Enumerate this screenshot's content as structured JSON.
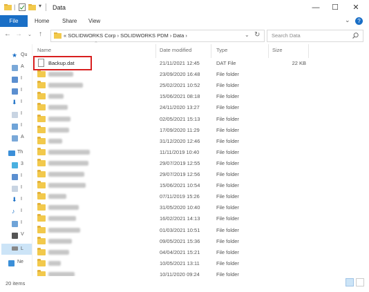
{
  "window": {
    "title": "Data",
    "controls": {
      "minimize": "—",
      "maximize": "☐",
      "close": "✕"
    }
  },
  "ribbon": {
    "file_tab": "File",
    "tabs": [
      "Home",
      "Share",
      "View"
    ]
  },
  "address": {
    "prefix": "«",
    "breadcrumb": [
      "SOLIDWORKS Corp",
      "SOLIDWORKS PDM",
      "Data"
    ],
    "separator": "›"
  },
  "search": {
    "placeholder": "Search Data"
  },
  "sidebar": {
    "items": [
      {
        "label": "Qu",
        "icon": "star-icon"
      },
      {
        "label": "A",
        "icon": "app-icon"
      },
      {
        "label": "I",
        "icon": "drive-icon"
      },
      {
        "label": "I",
        "icon": "drive-icon"
      },
      {
        "label": "I",
        "icon": "download-icon"
      },
      {
        "label": "I",
        "icon": "document-icon"
      },
      {
        "label": "I",
        "icon": "picture-icon"
      },
      {
        "label": "A",
        "icon": "app-icon"
      },
      {
        "label": "Th",
        "icon": "computer-icon"
      },
      {
        "label": "3",
        "icon": "cube-icon"
      },
      {
        "label": "I",
        "icon": "drive-icon"
      },
      {
        "label": "I",
        "icon": "document-icon"
      },
      {
        "label": "I",
        "icon": "download-icon"
      },
      {
        "label": "I",
        "icon": "music-icon"
      },
      {
        "label": "I",
        "icon": "picture-icon"
      },
      {
        "label": "V",
        "icon": "video-icon"
      },
      {
        "label": "L",
        "icon": "disk-icon"
      },
      {
        "label": "Ne",
        "icon": "network-icon"
      }
    ]
  },
  "columns": {
    "name": "Name",
    "date": "Date modified",
    "type": "Type",
    "size": "Size"
  },
  "files": [
    {
      "name": "Backup.dat",
      "date": "21/11/2021 12:45",
      "type": "DAT File",
      "size": "22 KB",
      "kind": "file",
      "highlighted": true
    },
    {
      "name": "",
      "date": "23/09/2020 16:48",
      "type": "File folder",
      "size": "",
      "kind": "folder",
      "highlighted": false
    },
    {
      "name": "",
      "date": "25/02/2021 10:52",
      "type": "File folder",
      "size": "",
      "kind": "folder",
      "highlighted": false
    },
    {
      "name": "",
      "date": "15/06/2021 08:18",
      "type": "File folder",
      "size": "",
      "kind": "folder",
      "highlighted": false
    },
    {
      "name": "",
      "date": "24/11/2020 13:27",
      "type": "File folder",
      "size": "",
      "kind": "folder",
      "highlighted": false
    },
    {
      "name": "",
      "date": "02/05/2021 15:13",
      "type": "File folder",
      "size": "",
      "kind": "folder",
      "highlighted": false
    },
    {
      "name": "",
      "date": "17/09/2020 11:29",
      "type": "File folder",
      "size": "",
      "kind": "folder",
      "highlighted": false
    },
    {
      "name": "",
      "date": "31/12/2020 12:46",
      "type": "File folder",
      "size": "",
      "kind": "folder",
      "highlighted": false
    },
    {
      "name": "",
      "date": "11/11/2019 10:40",
      "type": "File folder",
      "size": "",
      "kind": "folder",
      "highlighted": false
    },
    {
      "name": "",
      "date": "29/07/2019 12:55",
      "type": "File folder",
      "size": "",
      "kind": "folder",
      "highlighted": false
    },
    {
      "name": "",
      "date": "29/07/2019 12:56",
      "type": "File folder",
      "size": "",
      "kind": "folder",
      "highlighted": false
    },
    {
      "name": "",
      "date": "15/06/2021 10:54",
      "type": "File folder",
      "size": "",
      "kind": "folder",
      "highlighted": false
    },
    {
      "name": "",
      "date": "07/11/2019 15:26",
      "type": "File folder",
      "size": "",
      "kind": "folder",
      "highlighted": false
    },
    {
      "name": "",
      "date": "31/05/2020 10:40",
      "type": "File folder",
      "size": "",
      "kind": "folder",
      "highlighted": false
    },
    {
      "name": "",
      "date": "16/02/2021 14:13",
      "type": "File folder",
      "size": "",
      "kind": "folder",
      "highlighted": false
    },
    {
      "name": "",
      "date": "01/03/2021 10:51",
      "type": "File folder",
      "size": "",
      "kind": "folder",
      "highlighted": false
    },
    {
      "name": "",
      "date": "09/05/2021 15:36",
      "type": "File folder",
      "size": "",
      "kind": "folder",
      "highlighted": false
    },
    {
      "name": "",
      "date": "04/04/2021 15:21",
      "type": "File folder",
      "size": "",
      "kind": "folder",
      "highlighted": false
    },
    {
      "name": "",
      "date": "10/05/2021 13:11",
      "type": "File folder",
      "size": "",
      "kind": "folder",
      "highlighted": false
    },
    {
      "name": "",
      "date": "10/11/2020 09:24",
      "type": "File folder",
      "size": "",
      "kind": "folder",
      "highlighted": false
    }
  ],
  "status": {
    "items_count": "20 items"
  },
  "colors": {
    "accent": "#1a6fc6",
    "highlight_border": "#d81e1e",
    "folder": "#f2c94c"
  }
}
